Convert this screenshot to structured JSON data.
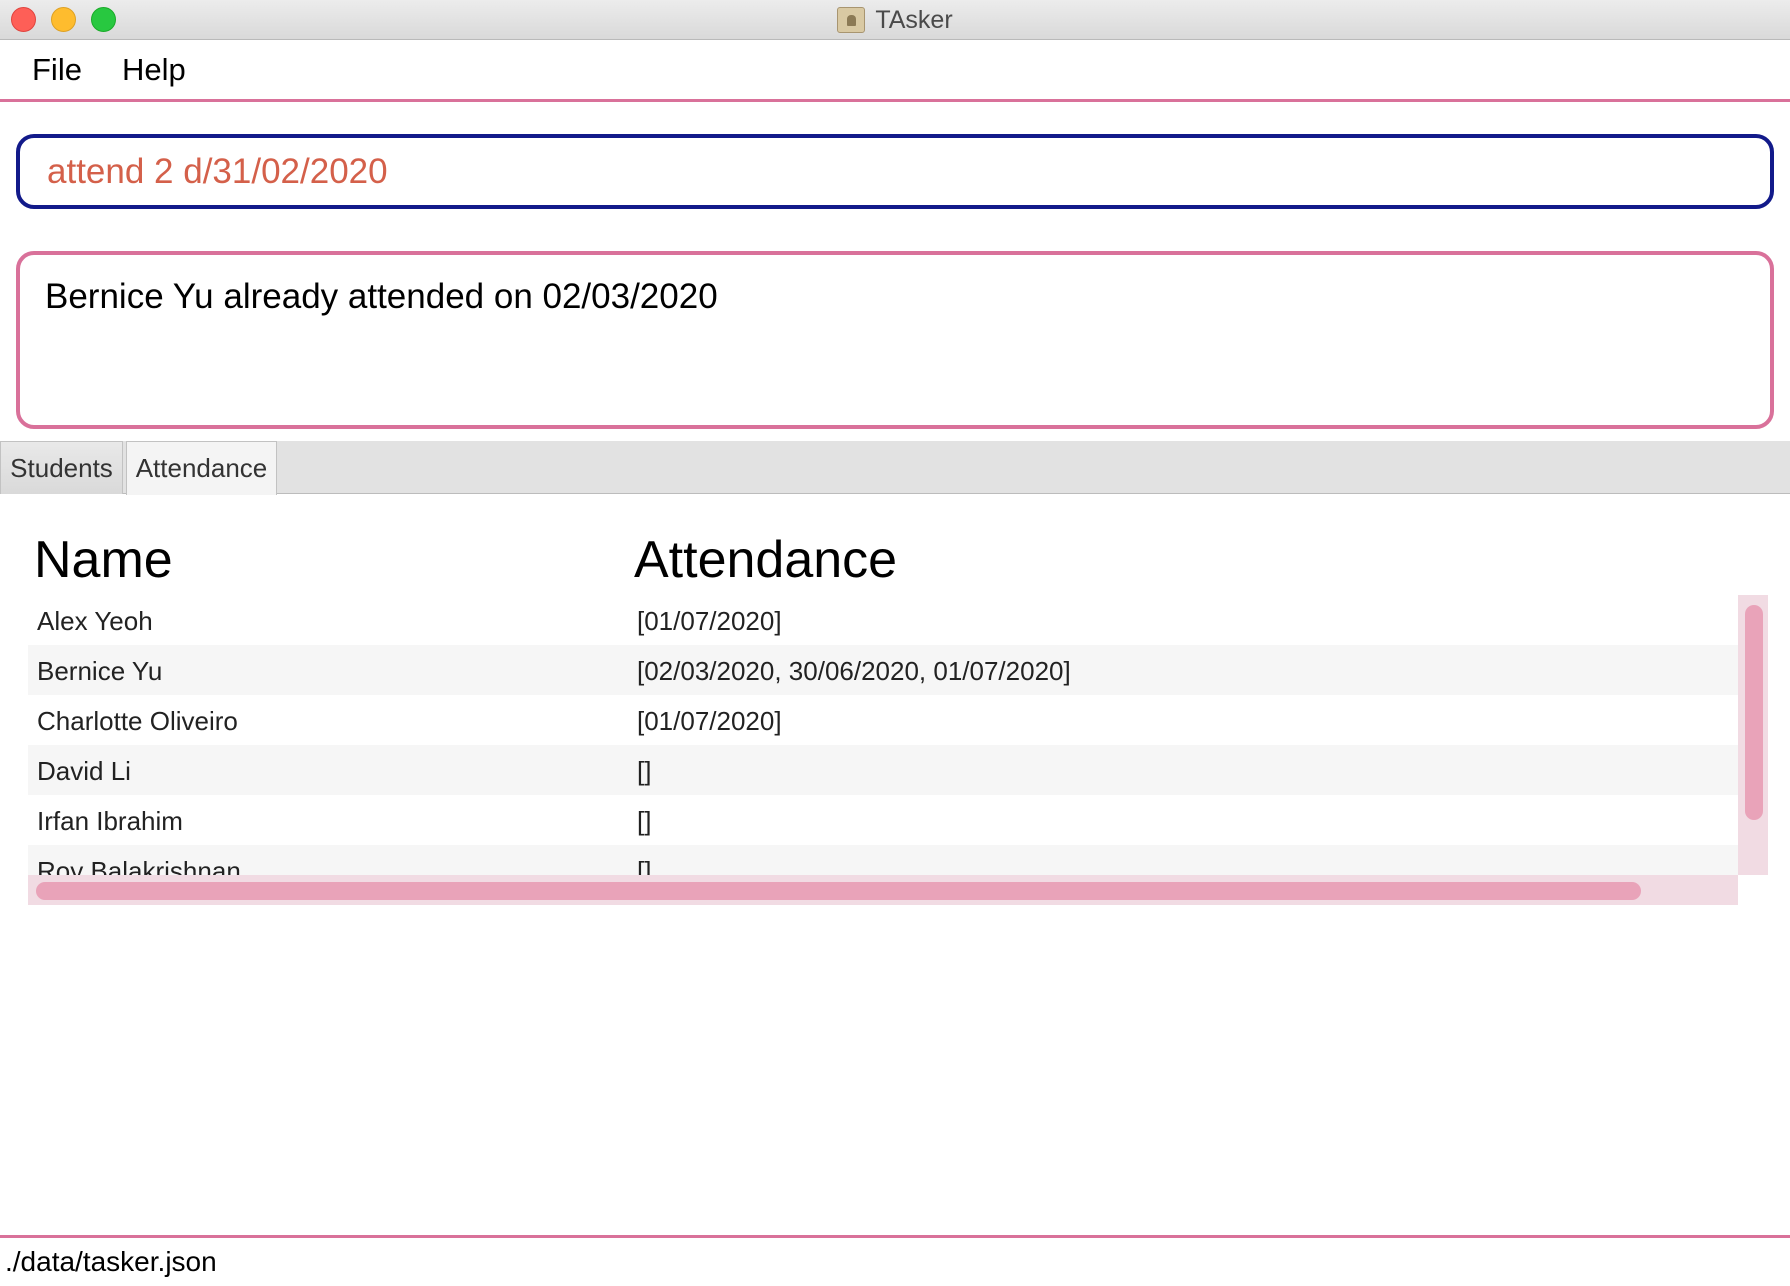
{
  "window": {
    "title": "TAsker"
  },
  "menu": {
    "items": [
      "File",
      "Help"
    ]
  },
  "command": {
    "value": "attend 2 d/31/02/2020"
  },
  "result": {
    "message": "Bernice Yu already attended on 02/03/2020"
  },
  "tabs": [
    {
      "label": "Students",
      "selected": false
    },
    {
      "label": "Attendance",
      "selected": true
    }
  ],
  "table": {
    "columns": [
      "Name",
      "Attendance"
    ],
    "rows": [
      {
        "name": "Alex Yeoh",
        "attendance": "[01/07/2020]"
      },
      {
        "name": "Bernice Yu",
        "attendance": "[02/03/2020, 30/06/2020, 01/07/2020]"
      },
      {
        "name": "Charlotte Oliveiro",
        "attendance": "[01/07/2020]"
      },
      {
        "name": "David Li",
        "attendance": "[]"
      },
      {
        "name": "Irfan Ibrahim",
        "attendance": "[]"
      },
      {
        "name": "Roy Balakrishnan",
        "attendance": "[]"
      }
    ]
  },
  "status": {
    "file_path": "./data/tasker.json"
  },
  "colors": {
    "accent": "#d9719a",
    "command_border": "#121a8a",
    "command_text": "#d4604a",
    "scroll_track": "#f1dbe3",
    "scroll_thumb": "#e9a3b9"
  }
}
